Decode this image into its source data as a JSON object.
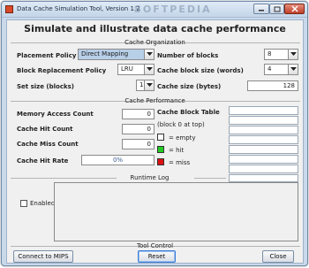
{
  "window": {
    "title": "Data Cache Simulation Tool, Version 1.2",
    "watermark": "SOFTPEDIA"
  },
  "heading": "Simulate and illustrate data cache performance",
  "cache_organization": {
    "title": "Cache Organization",
    "placement_policy": {
      "label": "Placement Policy",
      "value": "Direct Mapping"
    },
    "replacement_policy": {
      "label": "Block Replacement Policy",
      "value": "LRU"
    },
    "set_size": {
      "label": "Set size (blocks)",
      "value": "1"
    },
    "number_of_blocks": {
      "label": "Number of blocks",
      "value": "8"
    },
    "block_size": {
      "label": "Cache block size (words)",
      "value": "4"
    },
    "cache_size": {
      "label": "Cache size (bytes)",
      "value": "128"
    }
  },
  "cache_performance": {
    "title": "Cache Performance",
    "memory_access_count": {
      "label": "Memory Access Count",
      "value": "0"
    },
    "cache_hit_count": {
      "label": "Cache Hit Count",
      "value": "0"
    },
    "cache_miss_count": {
      "label": "Cache Miss Count",
      "value": "0"
    },
    "cache_hit_rate": {
      "label": "Cache Hit Rate",
      "value": "0%"
    },
    "block_table": {
      "title": "Cache Block Table",
      "subtitle": "(block 0 at top)",
      "legend": [
        {
          "label": "= empty",
          "color": "#ffffff"
        },
        {
          "label": "= hit",
          "color": "#22cc22"
        },
        {
          "label": "= miss",
          "color": "#dd1111"
        }
      ]
    }
  },
  "runtime_log": {
    "title": "Runtime Log",
    "enabled_label": "Enabled"
  },
  "tool_control": {
    "title": "Tool Control",
    "connect_label": "Connect to MIPS",
    "reset_label": "Reset",
    "close_label": "Close"
  }
}
